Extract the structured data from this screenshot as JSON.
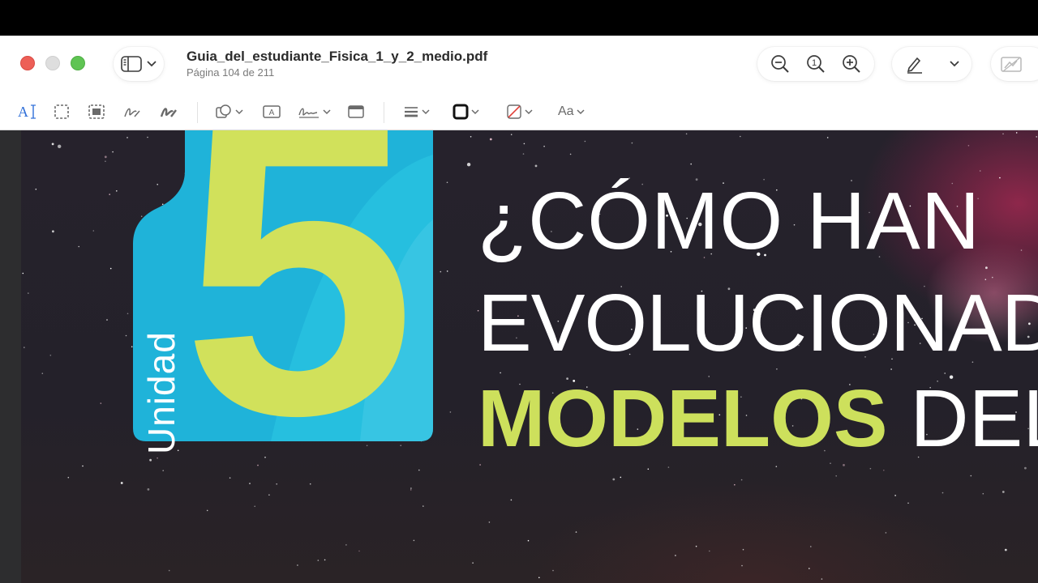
{
  "window": {
    "document_title": "Guia_del_estudiante_Fisica_1_y_2_medio.pdf",
    "page_indicator": "Página 104 de 211",
    "zoom_actual_label": "1"
  },
  "toolbar": {
    "text_selection_label": "A",
    "font_label": "Aa"
  },
  "page": {
    "unit_label": "Unidad",
    "unit_number": "5",
    "headline_line1": "¿CÓMO HAN",
    "headline_line2": "EVOLUCIONADO",
    "headline_line3_green": "MODELOS",
    "headline_line3_white": "DEL U",
    "colors": {
      "badge_blue": "#1fb3d9",
      "accent_green": "#d1e15b",
      "sky": "#24212a"
    }
  }
}
